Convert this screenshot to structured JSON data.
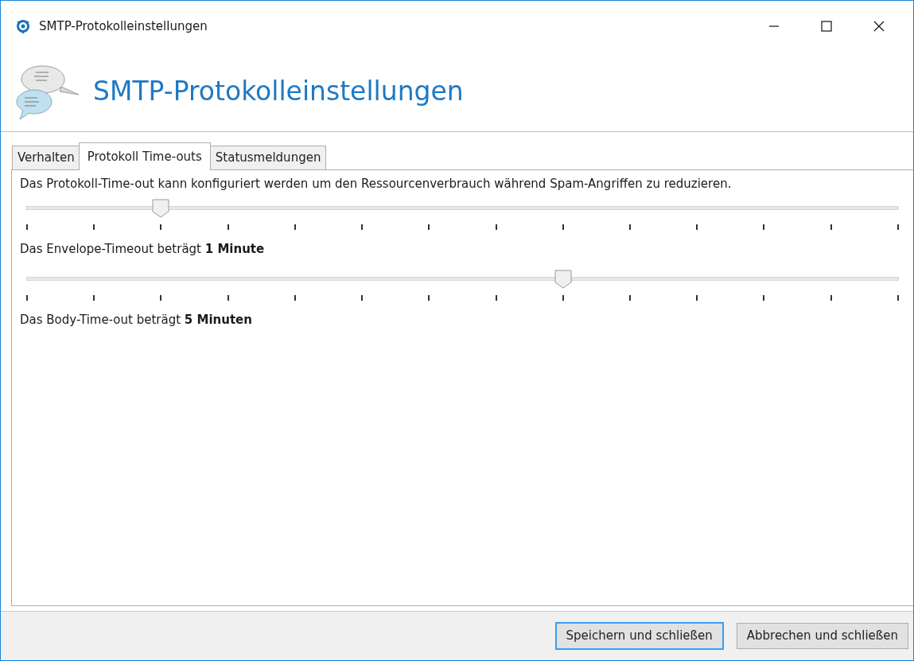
{
  "window": {
    "title": "SMTP-Protokolleinstellungen"
  },
  "header": {
    "title": "SMTP-Protokolleinstellungen"
  },
  "tabs": [
    {
      "label": "Verhalten",
      "selected": false
    },
    {
      "label": "Protokoll Time-outs",
      "selected": true
    },
    {
      "label": "Statusmeldungen",
      "selected": false
    }
  ],
  "description": "Das Protokoll-Time-out kann konfiguriert werden um den Ressourcenverbrauch während Spam-Angriffen zu reduzieren.",
  "sliders": [
    {
      "level": 0.1538,
      "reading": "Das Envelope-Timeout beträgt **1 Minute**"
    },
    {
      "level": 0.6154,
      "reading": "Das Body-Time-out beträgt **5 Minuten**"
    }
  ],
  "buttons": [
    {
      "label": "Speichern und schließen",
      "focused": true
    },
    {
      "label": "Abbrechen und schließen",
      "focused": false
    }
  ]
}
